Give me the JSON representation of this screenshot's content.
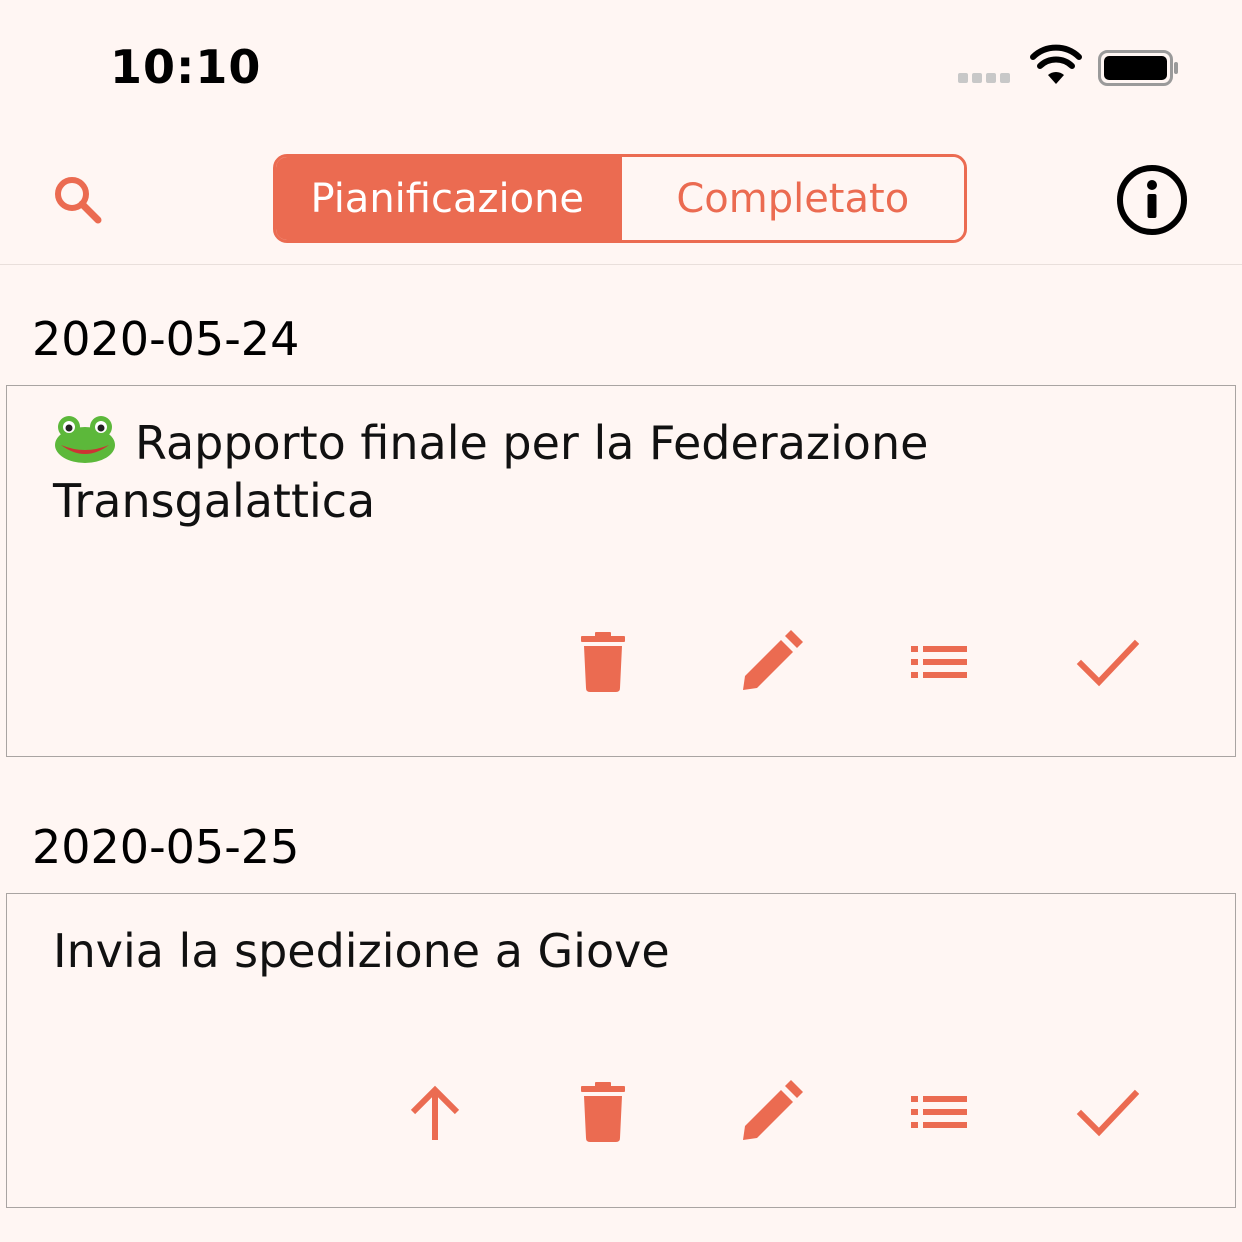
{
  "status_bar": {
    "time": "10:10"
  },
  "nav": {
    "segments": {
      "planning_label": "Pianificazione",
      "completed_label": "Completato",
      "selected": "Pianificazione"
    },
    "left_icon": "search-icon",
    "right_icon": "info-icon"
  },
  "colors": {
    "accent": "#eb6b51",
    "background": "#fff6f3",
    "card_border": "#a9a4a2"
  },
  "sections": [
    {
      "date": "2020-05-24",
      "task": {
        "title": "Rapporto finale per la Federazione Transgalattica",
        "leading_emoji": "frog-face-icon",
        "actions": [
          "delete-icon",
          "edit-icon",
          "list-icon",
          "check-icon"
        ]
      }
    },
    {
      "date": "2020-05-25",
      "task": {
        "title": "Invia la spedizione a Giove",
        "actions": [
          "arrow-up-icon",
          "delete-icon",
          "edit-icon",
          "list-icon",
          "check-icon"
        ]
      }
    }
  ]
}
